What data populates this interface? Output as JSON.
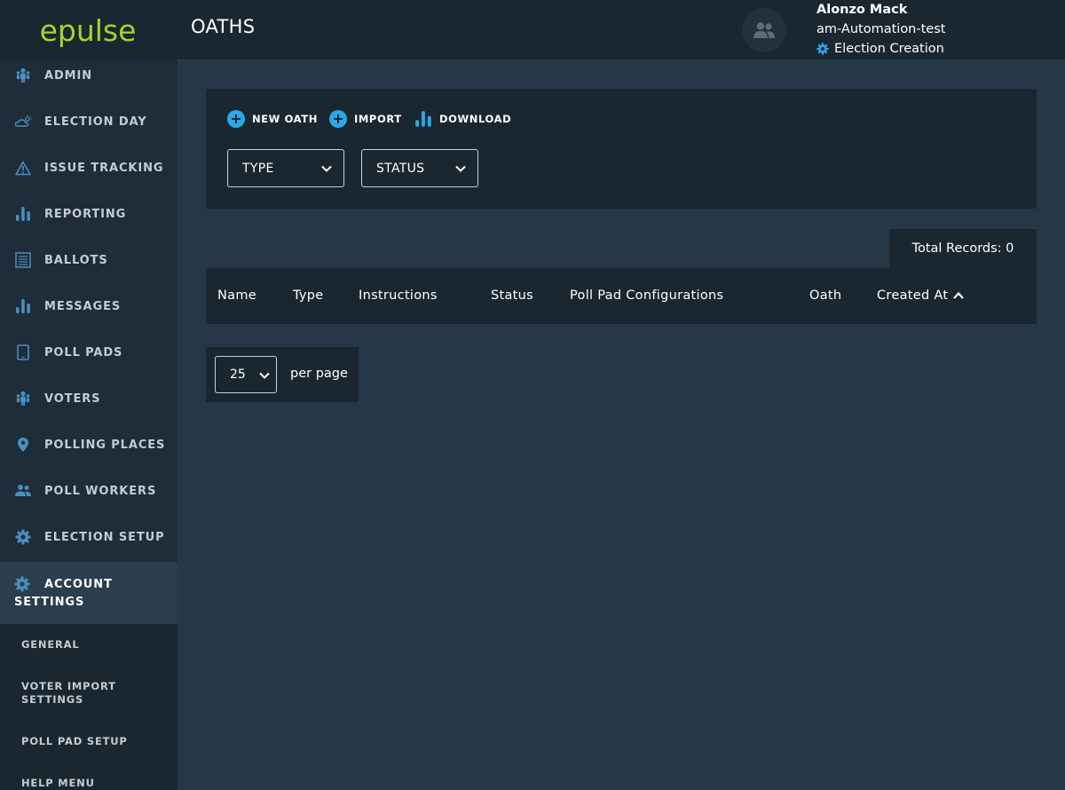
{
  "app": {
    "logo": "epulse",
    "page_title": "OATHS"
  },
  "sidebar": {
    "items": [
      {
        "label": "ADMIN",
        "icon": "people-icon"
      },
      {
        "label": "ELECTION DAY",
        "icon": "cloud-sun-icon"
      },
      {
        "label": "ISSUE TRACKING",
        "icon": "warning-icon"
      },
      {
        "label": "REPORTING",
        "icon": "bar-chart-icon"
      },
      {
        "label": "BALLOTS",
        "icon": "ballot-icon"
      },
      {
        "label": "MESSAGES",
        "icon": "bar-chart-icon"
      },
      {
        "label": "POLL PADS",
        "icon": "tablet-icon"
      },
      {
        "label": "VOTERS",
        "icon": "people-icon"
      },
      {
        "label": "POLLING PLACES",
        "icon": "map-pin-icon"
      },
      {
        "label": "POLL WORKERS",
        "icon": "workers-icon"
      },
      {
        "label": "ELECTION SETUP",
        "icon": "gear-icon"
      }
    ],
    "active": {
      "label_line1": "ACCOUNT",
      "label_line2": "SETTINGS",
      "icon": "gear-icon"
    },
    "subitems": [
      {
        "label": "GENERAL"
      },
      {
        "label": "VOTER IMPORT SETTINGS"
      },
      {
        "label": "POLL PAD SETUP"
      },
      {
        "label": "HELP MENU"
      }
    ]
  },
  "user": {
    "name": "Alonzo Mack",
    "org": "am-Automation-test",
    "mode": "Election Creation"
  },
  "toolbar": {
    "new_label": "NEW OATH",
    "import_label": "IMPORT",
    "download_label": "DOWNLOAD",
    "type_filter": "TYPE",
    "status_filter": "STATUS"
  },
  "table": {
    "total_records": "Total Records: 0",
    "columns": [
      "Name",
      "Type",
      "Instructions",
      "Status",
      "Poll Pad Configurations",
      "Oath",
      "Created At"
    ],
    "rows": []
  },
  "pagination": {
    "per_page_value": "25",
    "per_page_label": "per page"
  },
  "colors": {
    "background": "#263847",
    "panel": "#1a2731",
    "sidebar": "#1e2d39",
    "accent_blue": "#2aa8e8",
    "icon_blue": "#4a8fbf",
    "logo_green": "#a6d32a"
  }
}
